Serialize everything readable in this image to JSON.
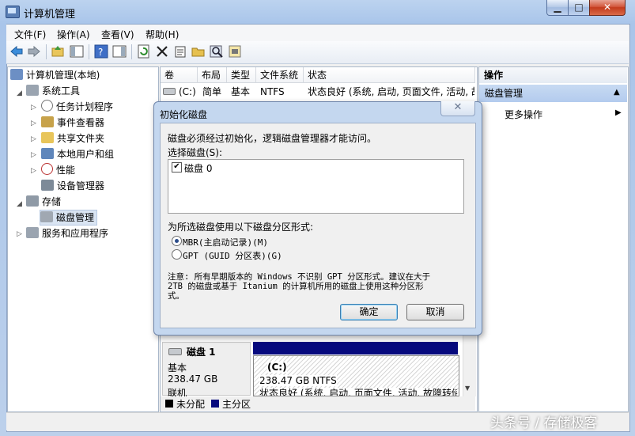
{
  "window": {
    "title": "计算机管理"
  },
  "menu": [
    "文件(F)",
    "操作(A)",
    "查看(V)",
    "帮助(H)"
  ],
  "toolbar_icons": [
    "back-icon",
    "forward-icon",
    "up-folder-icon",
    "show-tree-icon",
    "help-icon",
    "show-action-pane-icon",
    "refresh-icon",
    "delete-icon",
    "properties-icon",
    "open-icon",
    "search-icon",
    "disk-properties-icon"
  ],
  "tree": {
    "root": "计算机管理(本地)",
    "system_tools": "系统工具",
    "task_scheduler": "任务计划程序",
    "event_viewer": "事件查看器",
    "shared_folders": "共享文件夹",
    "local_users": "本地用户和组",
    "performance": "性能",
    "device_manager": "设备管理器",
    "storage": "存储",
    "disk_management": "磁盘管理",
    "services": "服务和应用程序"
  },
  "volume_list": {
    "columns": [
      "卷",
      "布局",
      "类型",
      "文件系统",
      "状态"
    ],
    "rows": [
      {
        "volume": "(C:)",
        "layout": "简单",
        "type": "基本",
        "fs": "NTFS",
        "status": "状态良好 (系统, 启动, 页面文件, 活动, 故"
      }
    ]
  },
  "disk_view": {
    "disk_name": "磁盘 1",
    "disk_type": "基本",
    "disk_size": "238.47 GB",
    "disk_status": "联机",
    "partition_label": "(C:)",
    "partition_size": "238.47 GB NTFS",
    "partition_status": "状态良好 (系统, 启动, 页面文件, 活动, 故障转储"
  },
  "legend": {
    "unallocated": "未分配",
    "primary": "主分区"
  },
  "actions": {
    "header": "操作",
    "section": "磁盘管理",
    "more": "更多操作"
  },
  "dialog": {
    "title": "初始化磁盘",
    "close": "✕",
    "intro": "磁盘必须经过初始化，逻辑磁盘管理器才能访问。",
    "select_label": "选择磁盘(S):",
    "disk_item": "磁盘 0",
    "partition_style_label": "为所选磁盘使用以下磁盘分区形式:",
    "mbr": "MBR(主启动记录)(M)",
    "gpt": "GPT (GUID 分区表)(G)",
    "note_line1": "注意: 所有早期版本的 Windows 不识别 GPT 分区形式。建议在大于",
    "note_line2": "2TB 的磁盘或基于 Itanium 的计算机所用的磁盘上使用这种分区形",
    "note_line3": "式。",
    "ok": "确定",
    "cancel": "取消"
  },
  "watermark": "头条号 / 存储极客",
  "colors": {
    "partition_bar": "#06097d",
    "unallocated": "#000000",
    "primary": "#06097d"
  }
}
